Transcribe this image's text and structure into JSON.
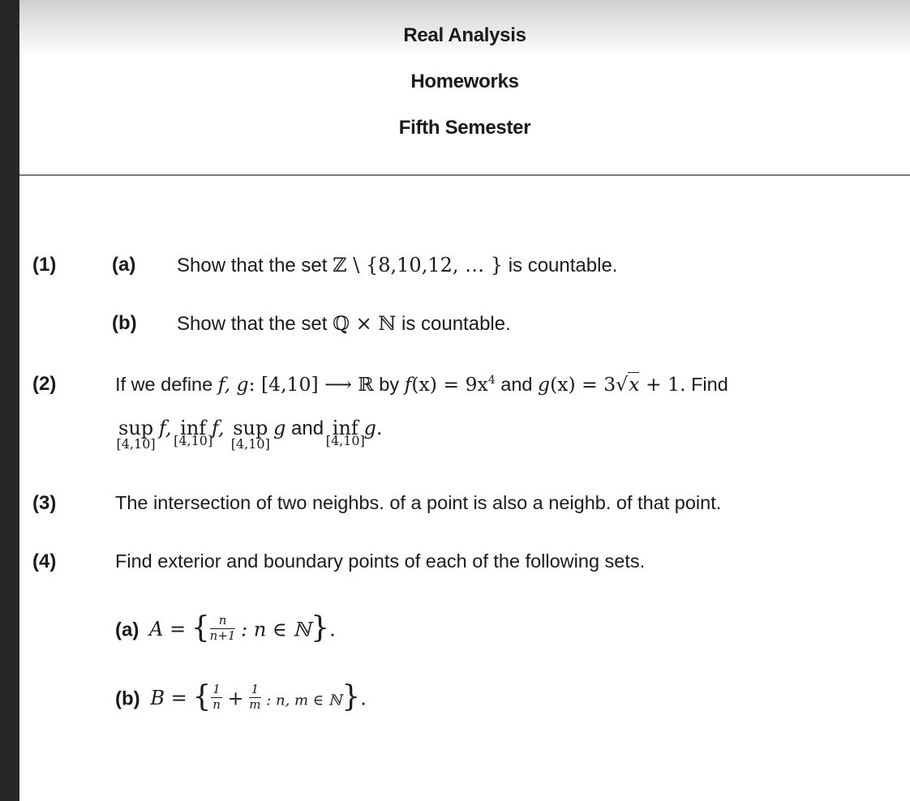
{
  "header": {
    "title": "Real Analysis",
    "subtitle": "Homeworks",
    "semester": "Fifth Semester"
  },
  "problems": [
    {
      "number": "(1)",
      "parts": [
        {
          "label": "(a)",
          "text_before": "Show that the set ",
          "math": "ℤ \\ {8,10,12, … }",
          "text_after": " is countable."
        },
        {
          "label": "(b)",
          "text_before": "Show that the set ",
          "math": "ℚ × ℕ",
          "text_after": " is countable."
        }
      ]
    },
    {
      "number": "(2)",
      "line1": {
        "t1": "If we define ",
        "m1": "f, g",
        "m2": ": [4,10] ⟶ ",
        "m3": "ℝ",
        "t2": " by ",
        "m4": "f",
        "m5": "(x) = 9x",
        "sup": "4",
        "t3": " and ",
        "m6": "g",
        "m7": "(x) = 3√",
        "m8": "x",
        "m9": " + 1.",
        "t4": " Find"
      },
      "line2": {
        "sup": "sup",
        "inf": "inf",
        "interval": "[4,10]",
        "f": "f",
        "g": "g",
        "comma": ",",
        "and": " and ",
        "period": "."
      }
    },
    {
      "number": "(3)",
      "text": "The intersection of two neighbs. of a point is also a neighb. of that point."
    },
    {
      "number": "(4)",
      "text": "Find exterior and boundary points of each of the following sets.",
      "parts": [
        {
          "label": "(a)",
          "lhs": "A =",
          "num": "n",
          "den": "n+1",
          "rest": ": n ∈ ℕ"
        },
        {
          "label": "(b)",
          "lhs": "B =",
          "num1": "1",
          "den1": "n",
          "plus": "+",
          "num2": "1",
          "den2": "m",
          "rest": ": n, m ∈ ℕ"
        }
      ]
    }
  ]
}
